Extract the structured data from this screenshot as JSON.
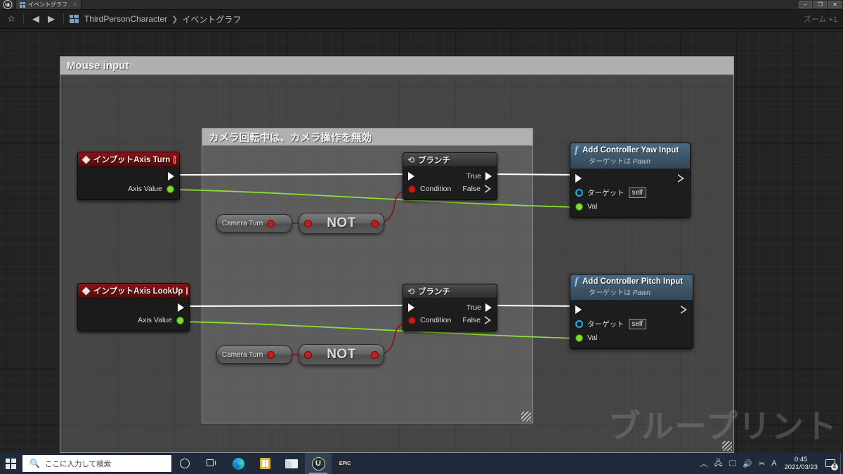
{
  "window": {
    "app_logo": "unreal-logo",
    "tab_label": "イベントグラフ",
    "tab_close": "×",
    "minimize": "–",
    "maximize": "❐",
    "close": "✕"
  },
  "toolbar": {
    "favorite_icon": "☆",
    "back_icon": "◀",
    "forward_icon": "▶",
    "breadcrumb_root": "ThirdPersonCharacter",
    "breadcrumb_sep": "❯",
    "breadcrumb_leaf": "イベントグラフ",
    "zoom_label": "ズーム +1"
  },
  "graph": {
    "watermark": "ブループリント",
    "comments": [
      {
        "title": "Mouse input"
      },
      {
        "title": "カメラ回転中は、カメラ操作を無効"
      }
    ],
    "nodes": {
      "input_turn": {
        "title": "インプットAxis Turn",
        "out_exec": "",
        "axis_value": "Axis Value"
      },
      "input_lookup": {
        "title": "インプットAxis LookUp",
        "out_exec": "",
        "axis_value": "Axis Value"
      },
      "camera_turn_1": {
        "label": "Camera Turn"
      },
      "camera_turn_2": {
        "label": "Camera Turn"
      },
      "not_1": {
        "label": "NOT"
      },
      "not_2": {
        "label": "NOT"
      },
      "branch_1": {
        "title": "ブランチ",
        "glyph": "⟲",
        "condition": "Condition",
        "true": "True",
        "false": "False"
      },
      "branch_2": {
        "title": "ブランチ",
        "glyph": "⟲",
        "condition": "Condition",
        "true": "True",
        "false": "False"
      },
      "yaw": {
        "f_glyph": "f",
        "title": "Add Controller Yaw Input",
        "subtitle_prefix": "ターゲットは ",
        "subtitle_type": "Pawn",
        "target_label": "ターゲット",
        "target_value": "self",
        "val_label": "Val"
      },
      "pitch": {
        "f_glyph": "f",
        "title": "Add Controller Pitch Input",
        "subtitle_prefix": "ターゲットは ",
        "subtitle_type": "Pawn",
        "target_label": "ターゲット",
        "target_value": "self",
        "val_label": "Val"
      }
    }
  },
  "colors": {
    "exec_wire": "#ffffff",
    "float_wire": "#8ce234",
    "bool_wire": "#8c1414",
    "event_header": "#6b0f0f",
    "function_header": "#3e5568",
    "exec_pin": "#ffffff",
    "float_pin": "#7bdc2a",
    "bool_pin": "#c41c1c",
    "object_pin": "#19b6e8",
    "comment_header": "#b0b0b0"
  },
  "taskbar": {
    "start_icon": "windows-logo",
    "search_placeholder": "ここに入力して検索",
    "search_icon": "🔍",
    "cortana_icon": "cortana-circle",
    "taskview_icon": "task-view",
    "apps": [
      {
        "name": "edge",
        "label": "Microsoft Edge"
      },
      {
        "name": "store",
        "label": "Microsoft Store"
      },
      {
        "name": "mail",
        "label": "Mail"
      },
      {
        "name": "unreal",
        "label": "Unreal Engine",
        "glyph": "U",
        "active": true
      },
      {
        "name": "epic",
        "label": "Epic Games",
        "glyph": "EPIC"
      }
    ],
    "tray": {
      "chevron": "︿",
      "icons": [
        "🖧",
        "🖵",
        "🔊",
        "✂",
        "A"
      ],
      "time": "0:45",
      "date": "2021/03/23",
      "notification_count": "2"
    }
  }
}
